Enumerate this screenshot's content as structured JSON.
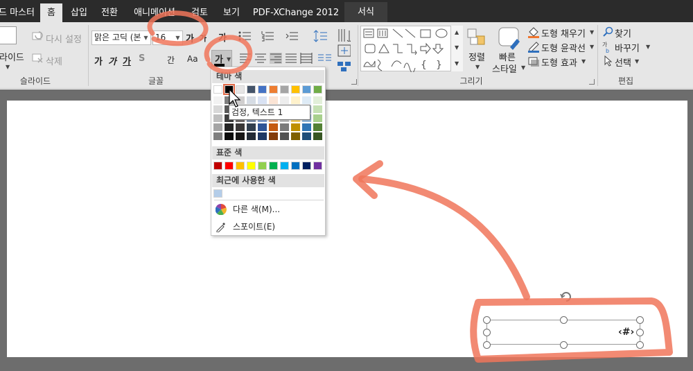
{
  "tabs": [
    {
      "label": "드 마스터",
      "active": false
    },
    {
      "label": "홈",
      "active": true
    },
    {
      "label": "삽입",
      "active": false
    },
    {
      "label": "전환",
      "active": false
    },
    {
      "label": "애니메이션",
      "active": false
    },
    {
      "label": "검토",
      "active": false
    },
    {
      "label": "보기",
      "active": false
    },
    {
      "label": "PDF-XChange 2012",
      "active": false
    },
    {
      "label": "서식",
      "active": false,
      "contextual": true
    }
  ],
  "ribbon": {
    "slides": {
      "reset": "다시 설정",
      "layout": "라이드",
      "delete": "삭제",
      "group_label": "슬라이드"
    },
    "font": {
      "font_name": "맑은 고딕 (본",
      "font_size": "16",
      "grow": "가",
      "shrink": "가",
      "clear": "가",
      "bold": "가",
      "italic": "가",
      "underline": "가",
      "shadow": "S",
      "spacing": "간",
      "change_case": "Aa",
      "font_color": "가",
      "group_label": "글꼴"
    },
    "drawing": {
      "arrange": "정렬",
      "quick_styles_line1": "빠른",
      "quick_styles_line2": "스타일",
      "fill": "도형 채우기",
      "outline": "도형 윤곽선",
      "effects": "도형 효과",
      "group_label": "그리기"
    },
    "editing": {
      "find": "찾기",
      "replace": "바꾸기",
      "select": "선택",
      "group_label": "편집"
    }
  },
  "color_menu": {
    "theme_header": "테마 색",
    "standard_header": "표준 색",
    "recent_header": "최근에 사용한 색",
    "more_colors": "다른 색(M)...",
    "eyedropper": "스포이트(E)",
    "tooltip": "검정, 텍스트 1",
    "theme_top": [
      "#ffffff",
      "#000000",
      "#e7e6e6",
      "#44546a",
      "#4472c4",
      "#ed7d31",
      "#a5a5a5",
      "#ffc000",
      "#5b9bd5",
      "#70ad47"
    ],
    "theme_shades": [
      [
        "#f2f2f2",
        "#7f7f7f",
        "#d0cece",
        "#d6dce4",
        "#d9e2f3",
        "#fbe4d5",
        "#ededed",
        "#fff2cc",
        "#deebf6",
        "#e2efd9"
      ],
      [
        "#d8d8d8",
        "#595959",
        "#aeabab",
        "#adb9ca",
        "#b4c6e7",
        "#f7cbac",
        "#dbdbdb",
        "#fee599",
        "#bdd7ee",
        "#c5e0b3"
      ],
      [
        "#bfbfbf",
        "#3f3f3f",
        "#757070",
        "#8496b0",
        "#8eaadb",
        "#f4b183",
        "#c9c9c9",
        "#ffd965",
        "#9cc3e5",
        "#a8d08d"
      ],
      [
        "#a5a5a5",
        "#262626",
        "#3a3838",
        "#323f4f",
        "#2f5496",
        "#c55a11",
        "#7b7b7b",
        "#bf9000",
        "#2e75b5",
        "#538135"
      ],
      [
        "#7f7f7f",
        "#0c0c0c",
        "#171616",
        "#222a35",
        "#1f3864",
        "#833c0b",
        "#525252",
        "#7f6000",
        "#1f4e79",
        "#375623"
      ]
    ],
    "standard": [
      "#c00000",
      "#ff0000",
      "#ffc000",
      "#ffff00",
      "#92d050",
      "#00b050",
      "#00b0f0",
      "#0070c0",
      "#002060",
      "#7030a0"
    ],
    "recent": [
      "#b4cde9"
    ]
  },
  "slide": {
    "placeholder_text": "‹#›"
  },
  "colors": {
    "annotation": "#f0765a",
    "tabbar": "#2b2b2b",
    "ribbon": "#e6e6e6"
  }
}
